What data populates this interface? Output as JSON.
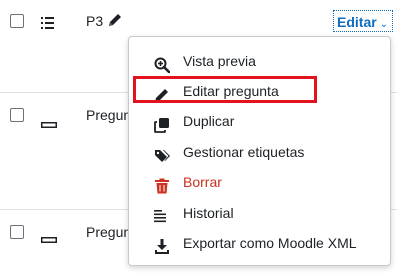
{
  "rows": [
    {
      "name": "P3",
      "icon": "multichoice-icon"
    },
    {
      "name": "Pregun",
      "icon": "shortanswer-icon"
    },
    {
      "name": "Pregun",
      "icon": "shortanswer-icon"
    }
  ],
  "edit_button": {
    "label": "Editar",
    "chevron": "⌄"
  },
  "menu": {
    "items": [
      {
        "label": "Vista previa",
        "icon": "zoom-in-icon"
      },
      {
        "label": "Editar pregunta",
        "icon": "pencil-icon"
      },
      {
        "label": "Duplicar",
        "icon": "copy-icon"
      },
      {
        "label": "Gestionar etiquetas",
        "icon": "tag-icon"
      },
      {
        "label": "Borrar",
        "icon": "trash-icon"
      },
      {
        "label": "Historial",
        "icon": "history-icon"
      },
      {
        "label": "Exportar como Moodle XML",
        "icon": "download-icon"
      }
    ]
  },
  "colors": {
    "accent": "#0f6cbf",
    "danger": "#ca3120",
    "highlight": "#e0131f"
  }
}
